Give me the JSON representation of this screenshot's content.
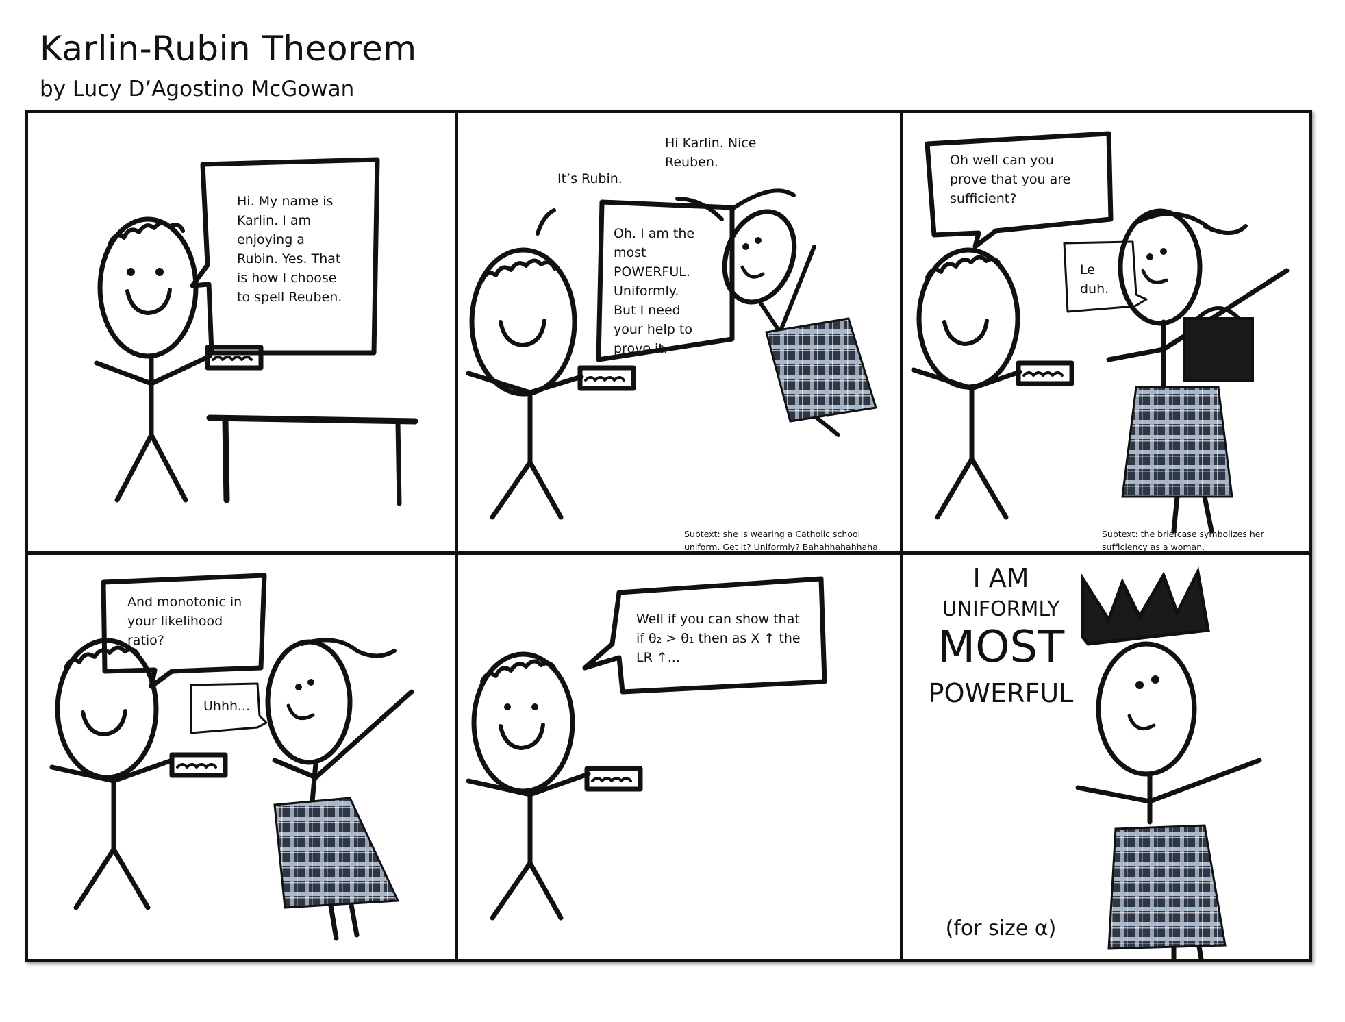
{
  "comic": {
    "title": "Karlin-Rubin Theorem",
    "byline": "by Lucy D’Agostino McGowan"
  },
  "panels": [
    {
      "karlin_says": "Hi. My name is\nKarlin. I am\nenjoying a\nRubin. Yes. That\nis how I choose\nto spell Reuben."
    },
    {
      "rubin_says": "Hi Karlin. Nice\nReuben.",
      "karlin_correction": "It’s Rubin.",
      "karlin_says": "Oh. I am the\nmost\nPOWERFUL.\nUniformly.\nBut I need\nyour help to\nprove it.",
      "subtext": "Subtext: she is wearing a Catholic school\nuniform. Get it? Uniformly? Bahahhahahhaha."
    },
    {
      "rubin_says": "Oh well can you\nprove that you are\nsufficient?",
      "karlin_says": "Le\nduh.",
      "subtext": "Subtext: the briefcase symbolizes her\nsufficiency as a woman."
    },
    {
      "rubin_says": "And monotonic in\nyour likelihood\nratio?",
      "karlin_says": "Uhhh..."
    },
    {
      "rubin_says": "Well if you can show that\nif θ₂ > θ₁ then as X ↑ the\nLR ↑..."
    },
    {
      "line1": "I AM",
      "line2": "UNIFORMLY",
      "line3": "MOST",
      "line4": "POWERFUL",
      "footnote": "(for size α)"
    }
  ],
  "colors": {
    "ink": "#111111",
    "skirt_dark": "#2f3746",
    "skirt_light": "#a9b8c8"
  }
}
